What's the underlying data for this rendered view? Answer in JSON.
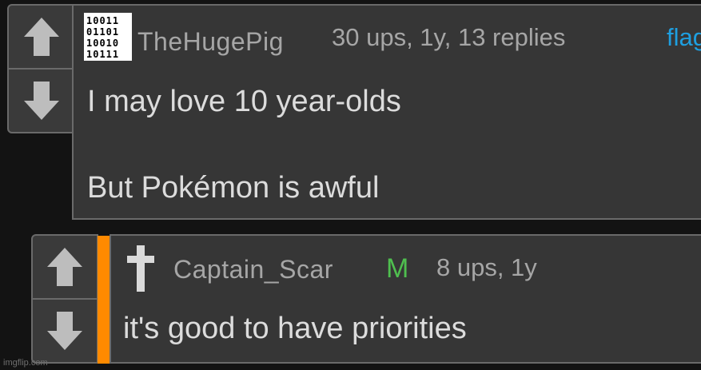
{
  "comments": [
    {
      "username": "TheHugePig",
      "meta": "30 ups, 1y, 13 replies",
      "flag_label": "flag",
      "lines": [
        "I may love 10 year-olds",
        "But Pokémon is awful"
      ],
      "avatar_rows": [
        "10011",
        "01101",
        "10010",
        "10111"
      ]
    },
    {
      "username": "Captain_Scar",
      "mod_badge": "M",
      "meta": "8 ups, 1y",
      "lines": [
        "it's good to have priorities"
      ],
      "op_bar_color": "#ff8a00"
    }
  ],
  "icons": {
    "upvote": "arrow-up-icon",
    "downvote": "arrow-down-icon",
    "avatar2": "cross-icon"
  },
  "colors": {
    "accent_flag": "#1e9fe0",
    "mod": "#4fbf4f",
    "op_bar": "#ff8a00",
    "panel": "#363636"
  },
  "watermark": "imgflip.com"
}
